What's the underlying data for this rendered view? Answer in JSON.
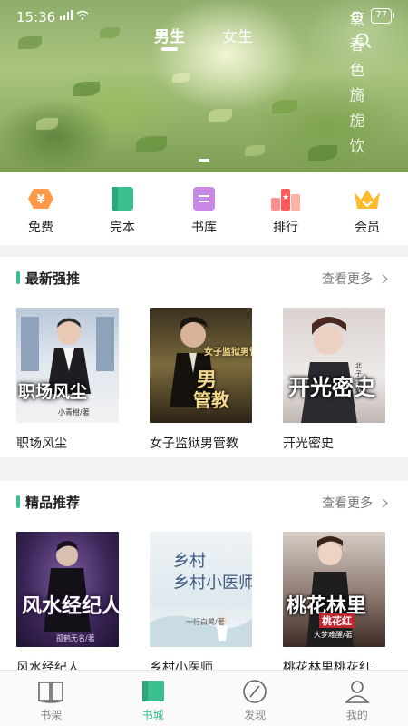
{
  "status_bar": {
    "time": "15:36",
    "battery": "77"
  },
  "header": {
    "tabs": [
      {
        "label": "男生",
        "active": true
      },
      {
        "label": "女生",
        "active": false
      }
    ],
    "search_icon": "search-icon"
  },
  "banner": {
    "poem_chars": "氧春色旖旎饮"
  },
  "categories": [
    {
      "label": "免费",
      "icon": "coin-icon",
      "color": "#ff8a3d"
    },
    {
      "label": "完本",
      "icon": "book-icon",
      "color": "#3bbf8f"
    },
    {
      "label": "书库",
      "icon": "library-icon",
      "color": "#c77ae0"
    },
    {
      "label": "排行",
      "icon": "rank-icon",
      "color": "#ff5a5a"
    },
    {
      "label": "会员",
      "icon": "crown-icon",
      "color": "#ffb72b"
    }
  ],
  "sections": [
    {
      "title": "最新强推",
      "more": "查看更多",
      "books": [
        {
          "title": "职场风尘",
          "cover_text": "职场风尘",
          "cover_author": "小青柑/著"
        },
        {
          "title": "女子监狱男管教",
          "cover_text": "女子监狱男管教",
          "cover_author": ""
        },
        {
          "title": "开光密史",
          "cover_text": "开光密史",
          "cover_author": "北子衣 著"
        }
      ]
    },
    {
      "title": "精品推荐",
      "more": "查看更多",
      "books": [
        {
          "title": "风水经纪人",
          "cover_text": "风水经纪人",
          "cover_author": "孤鹤无名/著"
        },
        {
          "title": "乡村小医师",
          "cover_text": "乡村小医师",
          "cover_author": "一行白鹭/著"
        },
        {
          "title": "桃花林里桃花红",
          "cover_text": "桃花林里",
          "cover_subtitle": "桃花红",
          "cover_author": "大梦难醒/著"
        }
      ]
    }
  ],
  "bottom_nav": [
    {
      "label": "书架",
      "icon": "bookshelf-icon",
      "active": false
    },
    {
      "label": "书城",
      "icon": "bookstore-icon",
      "active": true
    },
    {
      "label": "发现",
      "icon": "compass-icon",
      "active": false
    },
    {
      "label": "我的",
      "icon": "profile-icon",
      "active": false
    }
  ],
  "colors": {
    "accent": "#3bbf8f",
    "text": "#222222",
    "muted": "#777777"
  }
}
